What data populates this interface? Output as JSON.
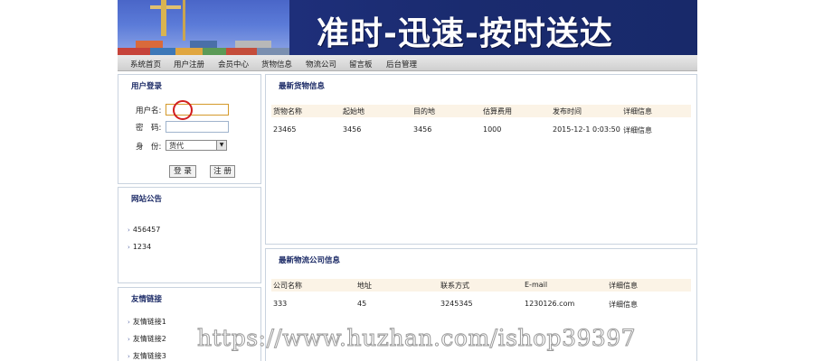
{
  "banner": {
    "title": "准时-迅速-按时送达"
  },
  "nav": {
    "items": [
      {
        "label": "系统首页"
      },
      {
        "label": "用户注册"
      },
      {
        "label": "会员中心"
      },
      {
        "label": "货物信息"
      },
      {
        "label": "物流公司"
      },
      {
        "label": "留言板"
      },
      {
        "label": "后台管理"
      }
    ]
  },
  "login": {
    "title": "用户登录",
    "username_label": "用户名:",
    "username_value": "",
    "password_label": "密　码:",
    "password_value": "",
    "role_label": "身　份:",
    "role_selected": "货代",
    "login_button": "登 录",
    "register_button": "注 册"
  },
  "notice": {
    "title": "网站公告",
    "items": [
      {
        "text": "456457"
      },
      {
        "text": "1234"
      }
    ]
  },
  "links": {
    "title": "友情链接",
    "items": [
      {
        "text": "友情链接1"
      },
      {
        "text": "友情链接2"
      },
      {
        "text": "友情链接3"
      }
    ]
  },
  "cargo": {
    "title": "最新货物信息",
    "columns": [
      "货物名称",
      "起始地",
      "目的地",
      "估算费用",
      "发布时间",
      "详细信息"
    ],
    "rows": [
      [
        "23465",
        "3456",
        "3456",
        "1000",
        "2015-12-1 0:03:50",
        "详细信息"
      ]
    ]
  },
  "company": {
    "title": "最新物流公司信息",
    "columns": [
      "公司名称",
      "地址",
      "联系方式",
      "E-mail",
      "详细信息"
    ],
    "rows": [
      [
        "333",
        "45",
        "3245345",
        "1230126.com",
        "详细信息"
      ]
    ]
  },
  "watermark": "https://www.huzhan.com/ishop39397",
  "colors": {
    "banner": "#1e2f7a",
    "panel_border": "#c9d3df",
    "title_text": "#1b2a66",
    "table_header": "#fbf3e6"
  }
}
